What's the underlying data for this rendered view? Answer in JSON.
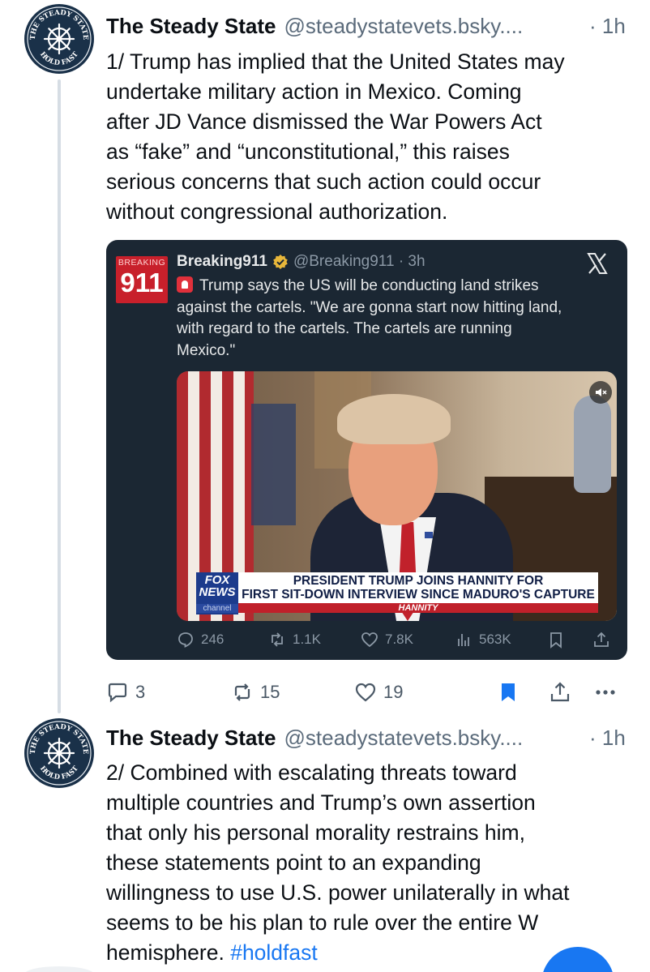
{
  "posts": [
    {
      "author_name": "The Steady State",
      "author_handle": "@steadystatevets.bsky....",
      "time": "· 1h",
      "avatar_text_top": "THE STEADY STATE",
      "avatar_text_bottom": "HOLD FAST",
      "lines": [
        "1/ Trump has implied that the United States may",
        "undertake military action in Mexico. Coming",
        "after JD Vance dismissed the War Powers Act",
        "as “fake” and “unconstitutional,” this raises",
        "serious concerns that such action could occur",
        "without congressional authorization."
      ],
      "embed": {
        "logo_small": "BREAKING",
        "logo_big": "911",
        "name": "Breaking911",
        "handle": "@Breaking911 · 3h",
        "lines": [
          "Trump says the US will be conducting land strikes",
          "against the cartels. \"We are gonna start now hitting land,",
          "with regard to the cartels. The cartels are running",
          "Mexico.\""
        ],
        "video": {
          "network_line1": "FOX",
          "network_line2": "NEWS",
          "network_line3": "channel",
          "chyron_line1": "PRESIDENT TRUMP JOINS HANNITY FOR",
          "chyron_line2": "FIRST SIT-DOWN INTERVIEW SINCE MADURO'S CAPTURE",
          "chyron_show": "HANNITY",
          "mute_icon": "mute-icon"
        },
        "stats": {
          "replies": "246",
          "reposts": "1.1K",
          "likes": "7.8K",
          "views": "563K"
        }
      },
      "actions": {
        "replies": "3",
        "reposts": "15",
        "likes": "19",
        "bookmarked": true
      }
    },
    {
      "author_name": "The Steady State",
      "author_handle": "@steadystatevets.bsky....",
      "time": "· 1h",
      "lines": [
        "2/ Combined with escalating threats toward",
        "multiple countries and Trump’s own assertion",
        "that only his personal morality restrains him,",
        "these statements point to an expanding",
        "willingness to use U.S. power unilaterally in what",
        "seems to be his plan to rule over the entire W"
      ],
      "last_line_text": "hemisphere. ",
      "hashtag": "#holdfast"
    }
  ],
  "colors": {
    "accent": "#1877f2",
    "avatar_bg": "#1a3149",
    "card_bg": "#1b2733",
    "muted": "#5b6b7b"
  }
}
